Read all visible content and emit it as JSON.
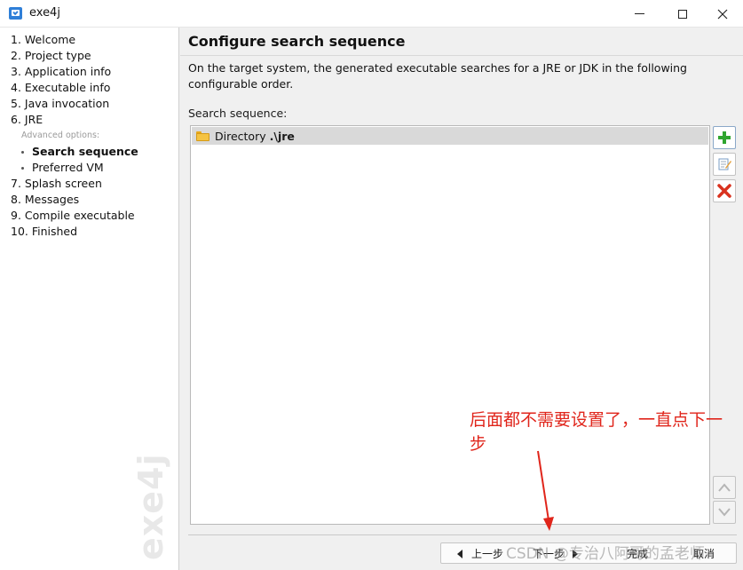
{
  "window": {
    "title": "exe4j",
    "app_icon": "exe4j-app-icon",
    "controls": [
      "minimize-icon",
      "maximize-icon",
      "close-icon"
    ]
  },
  "sidebar": {
    "items": [
      {
        "label": "1. Welcome"
      },
      {
        "label": "2. Project type"
      },
      {
        "label": "3. Application info"
      },
      {
        "label": "4. Executable info"
      },
      {
        "label": "5. Java invocation"
      },
      {
        "label": "6. JRE"
      }
    ],
    "advanced_label": "Advanced options:",
    "sub_items": [
      {
        "label": "Search sequence",
        "active": true
      },
      {
        "label": "Preferred VM",
        "active": false
      }
    ],
    "items_after": [
      {
        "label": "7. Splash screen"
      },
      {
        "label": "8. Messages"
      },
      {
        "label": "9. Compile executable"
      },
      {
        "label": "10. Finished"
      }
    ],
    "watermark": "exe4j"
  },
  "main": {
    "title": "Configure search sequence",
    "description": "On the target system, the generated executable searches for a JRE or JDK in the following configurable order.",
    "sequence_label": "Search sequence:",
    "sequence": [
      {
        "type": "Directory",
        "path": ".\\jre",
        "icon": "folder-icon"
      }
    ],
    "side_buttons": [
      "add-icon",
      "edit-icon",
      "remove-icon",
      "move-up-icon",
      "move-down-icon"
    ],
    "accent_colors": {
      "add": "#2fa52f",
      "remove": "#d9321f",
      "selection": "#d9d9d9"
    }
  },
  "buttons": {
    "back": "上一步",
    "next": "下一步",
    "finish": "完成",
    "cancel": "取消"
  },
  "annotation": {
    "text": "后面都不需要设置了，一直点下一步",
    "color": "#e0251b"
  },
  "overlay_watermark": "CSDN @专治八阿哥的孟老师"
}
